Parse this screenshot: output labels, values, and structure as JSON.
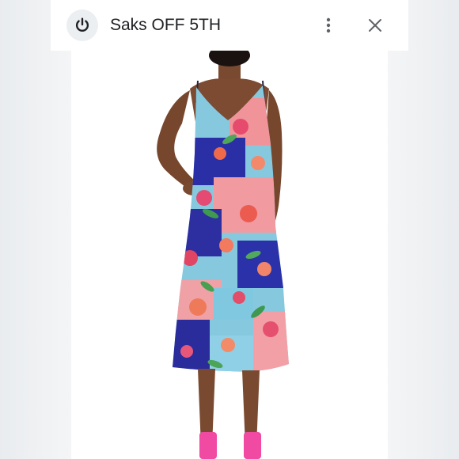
{
  "header": {
    "title": "Saks OFF 5TH",
    "app_icon": "power-icon",
    "more_icon": "more-vert-icon",
    "close_icon": "close-icon"
  },
  "content": {
    "image": "product-photo-floral-midi-dress"
  },
  "colors": {
    "header_bg": "#ffffff",
    "side_bg": "#eef0f2",
    "title_text": "#202124"
  }
}
